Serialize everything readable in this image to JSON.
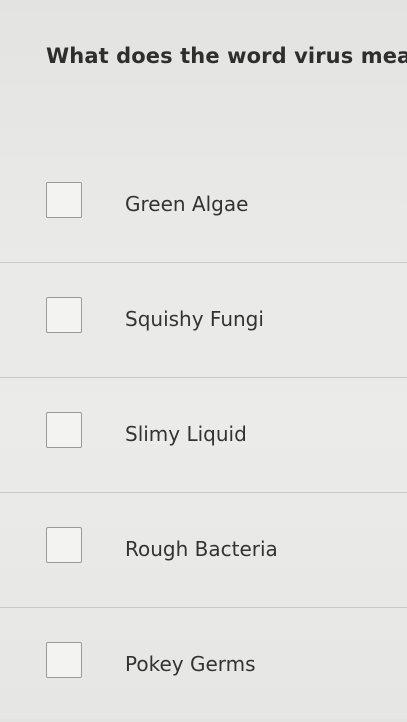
{
  "question": {
    "text": "What does the word virus mean"
  },
  "options": [
    {
      "label": "Green Algae",
      "checked": false
    },
    {
      "label": "Squishy Fungi",
      "checked": false
    },
    {
      "label": "Slimy Liquid",
      "checked": false
    },
    {
      "label": "Rough Bacteria",
      "checked": false
    },
    {
      "label": "Pokey Germs",
      "checked": false
    }
  ]
}
